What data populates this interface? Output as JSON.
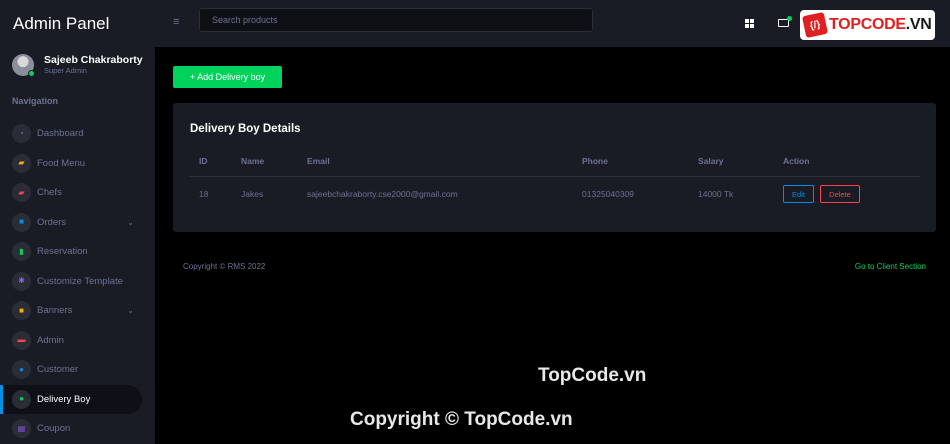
{
  "app": {
    "title": "Admin Panel"
  },
  "profile": {
    "name": "Sajeeb Chakraborty",
    "role": "Super Admin"
  },
  "navigation": {
    "title": "Navigation",
    "items": [
      {
        "label": "Dashboard",
        "icon": "speedometer-icon",
        "glyph": "◔",
        "color": "#8f5fe8",
        "caret": false,
        "active": false
      },
      {
        "label": "Food Menu",
        "icon": "food-icon",
        "glyph": "▰",
        "color": "#ffab00",
        "caret": false,
        "active": false
      },
      {
        "label": "Chefs",
        "icon": "chef-icon",
        "glyph": "▰",
        "color": "#fc424a",
        "caret": false,
        "active": false
      },
      {
        "label": "Orders",
        "icon": "orders-icon",
        "glyph": "■",
        "color": "#0090e7",
        "caret": true,
        "active": false
      },
      {
        "label": "Reservation",
        "icon": "chart-icon",
        "glyph": "▮",
        "color": "#00d25b",
        "caret": false,
        "active": false
      },
      {
        "label": "Customize Template",
        "icon": "settings-icon",
        "glyph": "✱",
        "color": "#8f5fe8",
        "caret": false,
        "active": false
      },
      {
        "label": "Banners",
        "icon": "banner-icon",
        "glyph": "■",
        "color": "#ffab00",
        "caret": true,
        "active": false
      },
      {
        "label": "Admin",
        "icon": "admin-icon",
        "glyph": "▬",
        "color": "#fc424a",
        "caret": false,
        "active": false
      },
      {
        "label": "Customer",
        "icon": "customer-icon",
        "glyph": "●",
        "color": "#0090e7",
        "caret": false,
        "active": false
      },
      {
        "label": "Delivery Boy",
        "icon": "delivery-boy-icon",
        "glyph": "●",
        "color": "#00d25b",
        "caret": false,
        "active": true
      },
      {
        "label": "Coupon",
        "icon": "coupon-icon",
        "glyph": "▤",
        "color": "#8f5fe8",
        "caret": false,
        "active": false
      }
    ]
  },
  "search": {
    "placeholder": "Search products"
  },
  "logo": {
    "mark": "{/}",
    "text_main": "TOPCODE",
    "text_suffix": ".VN"
  },
  "main": {
    "add_button": "+ Add Delivery boy",
    "card_title": "Delivery Boy Details",
    "table": {
      "headers": [
        "ID",
        "Name",
        "Email",
        "Phone",
        "Salary",
        "Action"
      ],
      "rows": [
        {
          "id": "18",
          "name": "Jakes",
          "email": "sajeebchakraborty.cse2000@gmail.com",
          "phone": "01325040309",
          "salary": "14000 Tk",
          "edit": "Edit",
          "delete": "Delete"
        }
      ]
    }
  },
  "footer": {
    "copyright": "Copyright © RMS 2022",
    "client_link": "Go to Client Section"
  },
  "watermark": {
    "line1": "TopCode.vn",
    "line2": "Copyright © TopCode.vn"
  },
  "colors": {
    "accent_green": "#00d25b",
    "accent_blue": "#0090e7",
    "accent_red": "#fc424a",
    "sidebar_bg": "#191c24"
  }
}
